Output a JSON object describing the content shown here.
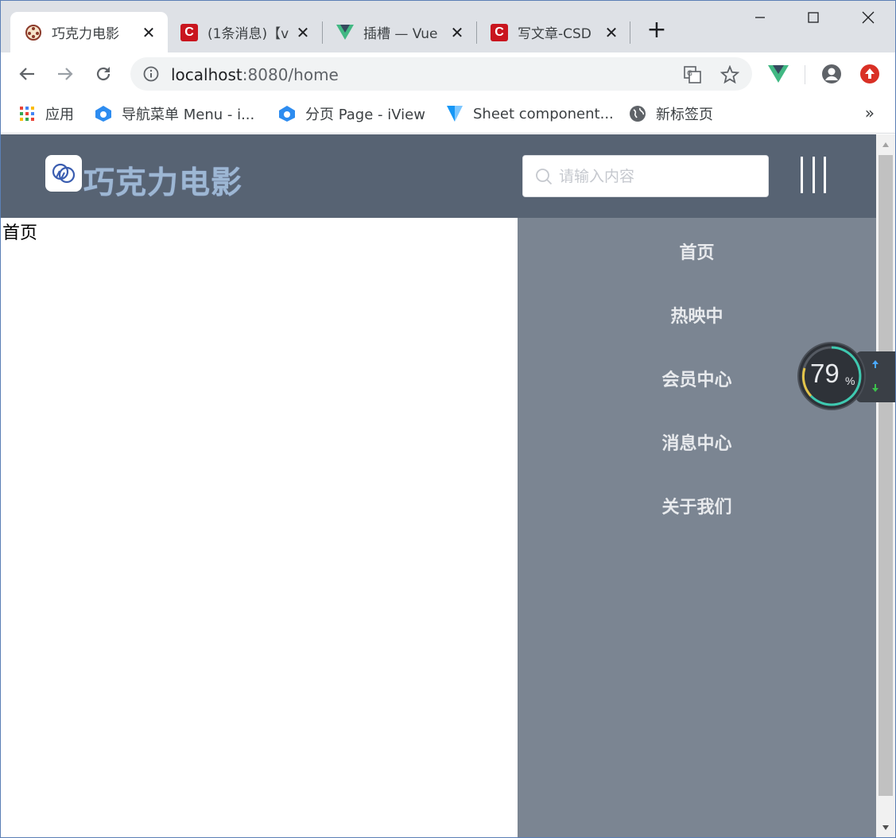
{
  "browser": {
    "tabs": [
      {
        "title": "巧克力电影",
        "icon": "film-reel-icon",
        "active": true
      },
      {
        "title": "(1条消息)【v",
        "icon": "csdn-icon"
      },
      {
        "title": "插槽 — Vue",
        "icon": "vue-icon"
      },
      {
        "title": "写文章-CSD",
        "icon": "csdn-icon"
      }
    ],
    "new_tab_label": "+",
    "url_host": "localhost",
    "url_rest": ":8080/home",
    "bookmarks": [
      {
        "label": "应用",
        "icon": "apps-grid-icon"
      },
      {
        "label": "导航菜单 Menu - i...",
        "icon": "iview-icon"
      },
      {
        "label": "分页 Page - iView",
        "icon": "iview-icon"
      },
      {
        "label": "Sheet component...",
        "icon": "vuetify-icon"
      },
      {
        "label": "新标签页",
        "icon": "globe-icon"
      }
    ],
    "bookmarks_more": "»"
  },
  "app": {
    "logo_text": "巧克力电影",
    "search_placeholder": "请输入内容",
    "page_text": "首页",
    "menu": [
      "首页",
      "热映中",
      "会员中心",
      "消息中心",
      "关于我们"
    ]
  },
  "gauge": {
    "value": "79",
    "unit": "%"
  },
  "colors": {
    "header": "#576373",
    "side_menu": "#7b8592",
    "tabstrip": "#dee1e6"
  }
}
